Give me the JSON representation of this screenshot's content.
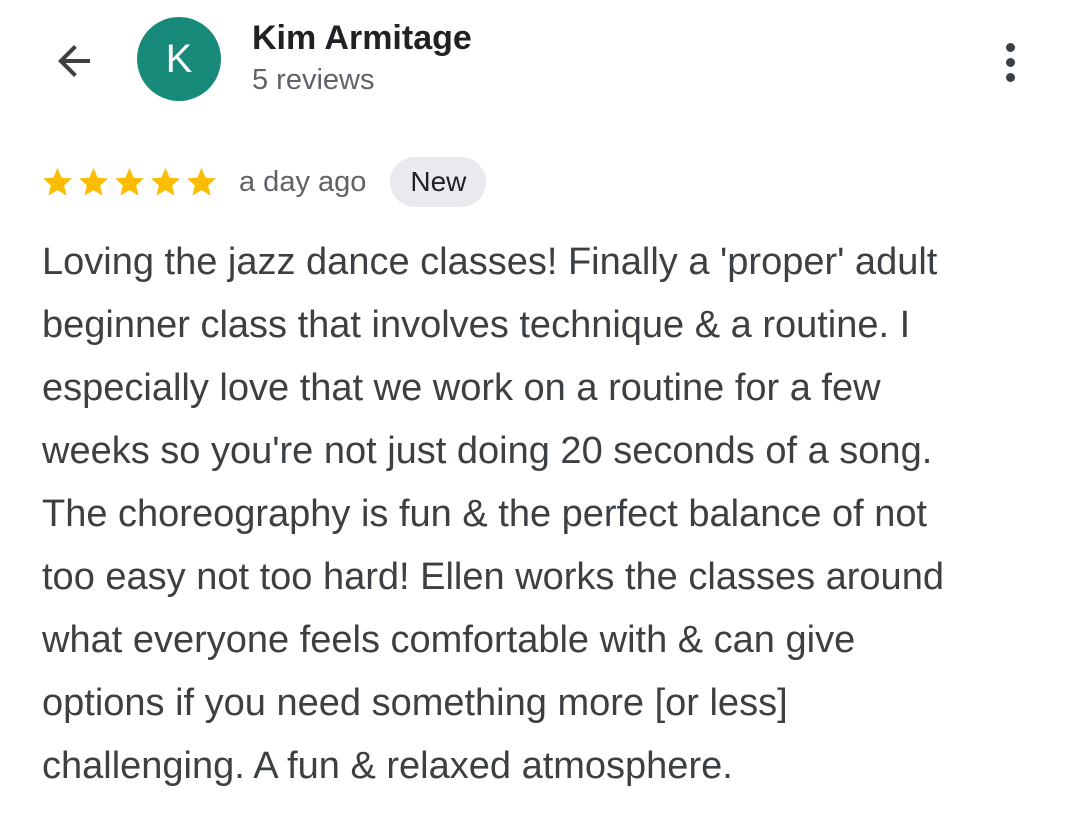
{
  "header": {
    "avatar_letter": "K",
    "reviewer_name": "Kim Armitage",
    "review_count": "5 reviews",
    "avatar_color": "#178a7a",
    "back_icon": "arrow-back-icon",
    "more_icon": "more-vert-icon"
  },
  "review": {
    "rating": 5,
    "rating_max": 5,
    "star_color": "#fbbc04",
    "date": "a day ago",
    "badge": "New",
    "text": "Loving the jazz dance classes! Finally a 'proper' adult\nbeginner class that involves technique & a routine. I\nespecially love that we work on a routine for a few\nweeks so you're not just doing 20 seconds of a song.\nThe choreography is fun & the perfect balance of not\ntoo easy not too hard! Ellen works the classes around\nwhat everyone feels comfortable with & can give\noptions if you need something more [or less]\nchallenging. A fun & relaxed atmosphere."
  }
}
